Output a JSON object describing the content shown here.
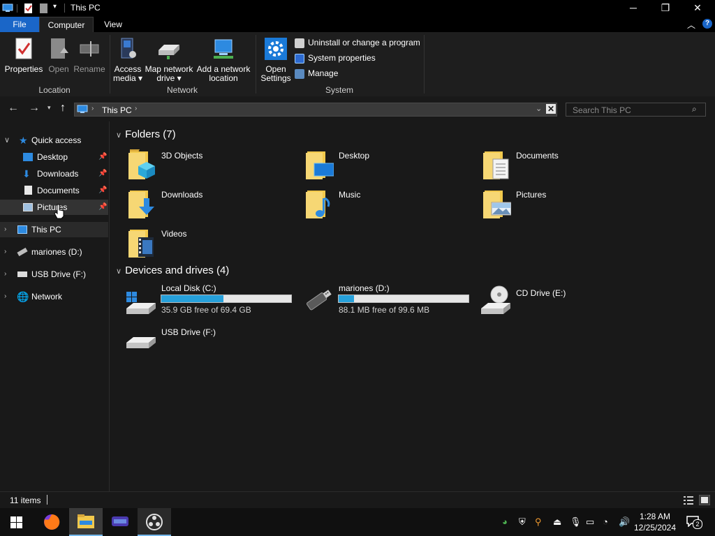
{
  "window": {
    "title": "This PC",
    "controls": {
      "minimize": "─",
      "restore": "❐",
      "close": "✕"
    }
  },
  "ribbon": {
    "tabs": [
      "File",
      "Computer",
      "View"
    ],
    "location": {
      "group_label": "Location",
      "properties": "Properties",
      "open": "Open",
      "rename": "Rename"
    },
    "network": {
      "group_label": "Network",
      "access_media_1": "Access",
      "access_media_2": "media",
      "map_drive_1": "Map network",
      "map_drive_2": "drive",
      "add_location_1": "Add a network",
      "add_location_2": "location"
    },
    "system": {
      "group_label": "System",
      "open_settings_1": "Open",
      "open_settings_2": "Settings",
      "uninstall": "Uninstall or change a program",
      "system_properties": "System properties",
      "manage": "Manage"
    }
  },
  "address": {
    "path": "This PC",
    "search_placeholder": "Search This PC"
  },
  "nav": {
    "quick_access": "Quick access",
    "qa_items": [
      "Desktop",
      "Downloads",
      "Documents",
      "Pictures"
    ],
    "this_pc": "This PC",
    "marione": "mariones (D:)",
    "usb": "USB Drive (F:)",
    "network": "Network"
  },
  "content": {
    "folders_header": "Folders (7)",
    "folders": [
      "3D Objects",
      "Desktop",
      "Documents",
      "Downloads",
      "Music",
      "Pictures",
      "Videos"
    ],
    "devices_header": "Devices and drives (4)",
    "drives": [
      {
        "name": "Local Disk (C:)",
        "free": "35.9 GB free of 69.4 GB",
        "used_fraction": 0.48
      },
      {
        "name": "mariones (D:)",
        "free": "88.1 MB free of 99.6 MB",
        "used_fraction": 0.12
      },
      {
        "name": "CD Drive (E:)"
      },
      {
        "name": "USB Drive (F:)"
      }
    ]
  },
  "status": {
    "items": "11 items"
  },
  "taskbar": {
    "time": "1:28 AM",
    "date": "12/25/2024",
    "notifications": "2"
  },
  "colors": {
    "accent": "#1a66c8",
    "drive_fill": "#26a0da",
    "background": "#191919"
  }
}
